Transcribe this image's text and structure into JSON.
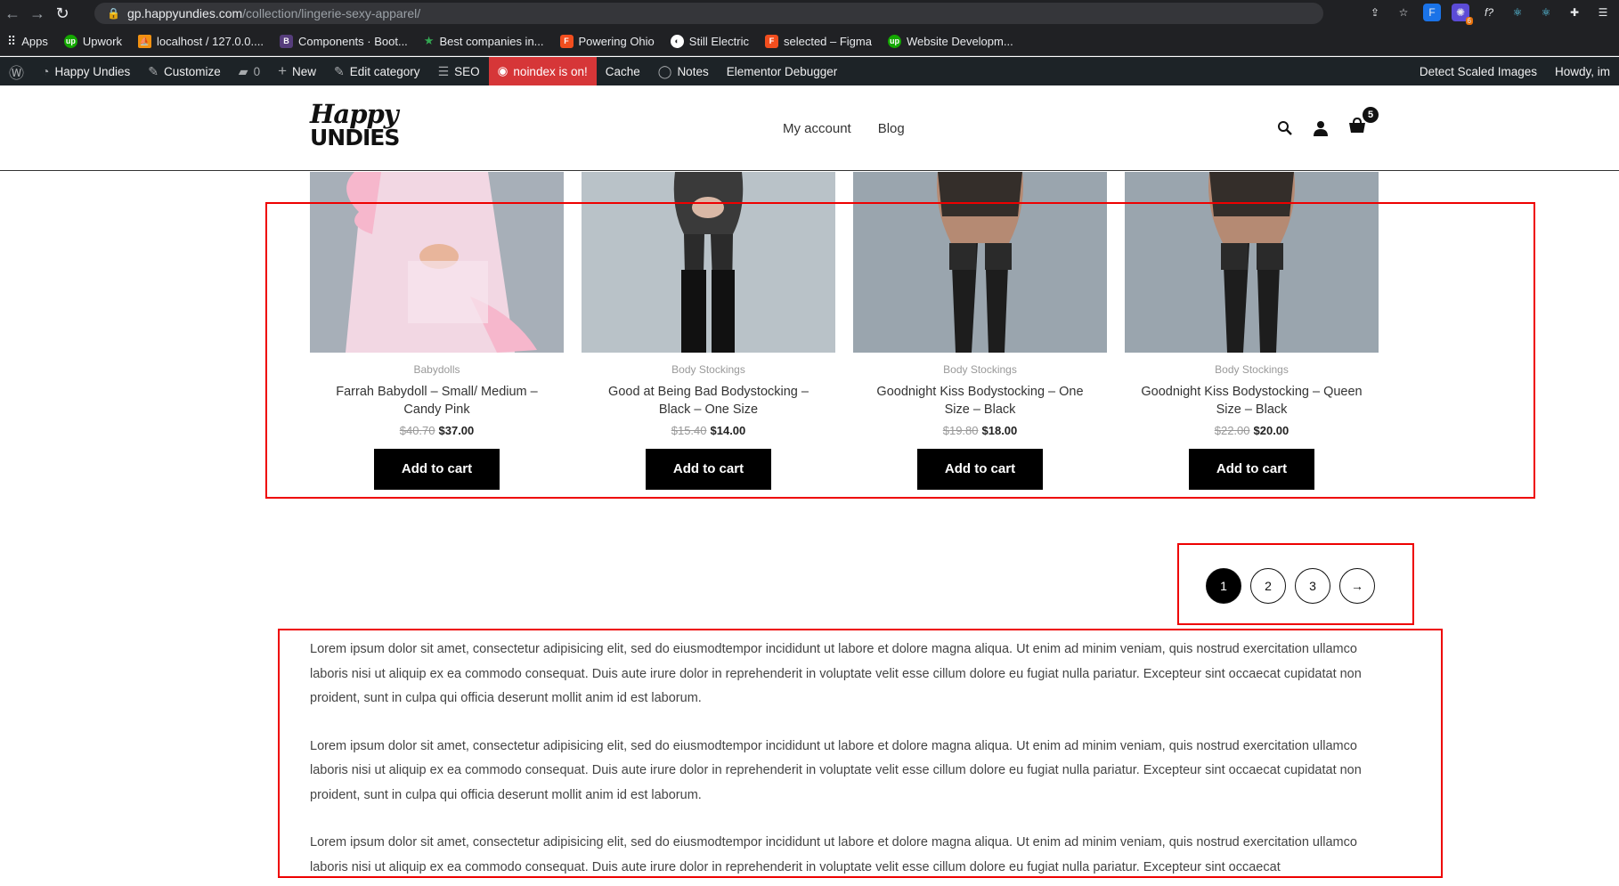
{
  "browser": {
    "url_host": "gp.happyundies.com",
    "url_path": "/collection/lingerie-sexy-apparel/",
    "extension_badge": "6",
    "bookmarks": [
      {
        "label": "Apps",
        "color": "#5f6368"
      },
      {
        "label": "Upwork",
        "color": "#14a800"
      },
      {
        "label": "localhost / 127.0.0....",
        "color": "#f29111"
      },
      {
        "label": "Components · Boot...",
        "color": "#563d7c"
      },
      {
        "label": "Best companies in...",
        "color": "#2e7d32"
      },
      {
        "label": "Powering Ohio",
        "color": "#a259ff"
      },
      {
        "label": "Still Electric",
        "color": "#777"
      },
      {
        "label": "selected – Figma",
        "color": "#f24e1e"
      },
      {
        "label": "Website Developm...",
        "color": "#14a800"
      }
    ]
  },
  "wp_admin_bar": {
    "site_name": "Happy Undies",
    "customize": "Customize",
    "comments_count": "0",
    "new": "New",
    "edit_category": "Edit category",
    "seo": "SEO",
    "noindex": "noindex is on!",
    "cache": "Cache",
    "notes": "Notes",
    "debugger": "Elementor Debugger",
    "detect_scaled": "Detect Scaled Images",
    "howdy": "Howdy, im"
  },
  "header": {
    "logo_line1": "Happy",
    "logo_line2": "UNDIES",
    "nav": [
      "My account",
      "Blog"
    ],
    "cart_count": "5"
  },
  "products": [
    {
      "category": "Babydolls",
      "title": "Farrah Babydoll – Small/ Medium – Candy Pink",
      "old_price": "$40.70",
      "price": "$37.00",
      "button": "Add to cart",
      "image": "pink-babydoll"
    },
    {
      "category": "Body Stockings",
      "title": "Good at Being Bad Bodystocking – Black – One Size",
      "old_price": "$15.40",
      "price": "$14.00",
      "button": "Add to cart",
      "image": "black-bodystocking-back"
    },
    {
      "category": "Body Stockings",
      "title": "Goodnight Kiss Bodystocking – One Size – Black",
      "old_price": "$19.80",
      "price": "$18.00",
      "button": "Add to cart",
      "image": "lace-bodystocking"
    },
    {
      "category": "Body Stockings",
      "title": "Goodnight Kiss Bodystocking – Queen Size – Black",
      "old_price": "$22.00",
      "price": "$20.00",
      "button": "Add to cart",
      "image": "lace-bodystocking"
    }
  ],
  "pagination": {
    "pages": [
      "1",
      "2",
      "3"
    ],
    "current": "1",
    "next": "→"
  },
  "description": {
    "paragraphs": [
      "Lorem ipsum dolor sit amet, consectetur adipisicing elit, sed do eiusmodtempor incididunt ut labore et dolore magna aliqua. Ut enim ad minim veniam, quis nostrud exercitation ullamco laboris nisi ut aliquip ex ea commodo consequat. Duis aute irure dolor in reprehenderit in voluptate velit esse cillum dolore eu fugiat nulla pariatur. Excepteur sint occaecat cupidatat non proident, sunt in culpa qui officia deserunt mollit anim id est laborum.",
      "Lorem ipsum dolor sit amet, consectetur adipisicing elit, sed do eiusmodtempor incididunt ut labore et dolore magna aliqua. Ut enim ad minim veniam, quis nostrud exercitation ullamco laboris nisi ut aliquip ex ea commodo consequat. Duis aute irure dolor in reprehenderit in voluptate velit esse cillum dolore eu fugiat nulla pariatur. Excepteur sint occaecat cupidatat non proident, sunt in culpa qui officia deserunt mollit anim id est laborum.",
      "Lorem ipsum dolor sit amet, consectetur adipisicing elit, sed do eiusmodtempor incididunt ut labore et dolore magna aliqua. Ut enim ad minim veniam, quis nostrud exercitation ullamco laboris nisi ut aliquip ex ea commodo consequat. Duis aute irure dolor in reprehenderit in voluptate velit esse cillum dolore eu fugiat nulla pariatur. Excepteur sint occaecat"
    ]
  },
  "colors": {
    "annotation": "#e00000",
    "button": "#000000",
    "admin_bar": "#1d2327",
    "noindex": "#d63638"
  }
}
